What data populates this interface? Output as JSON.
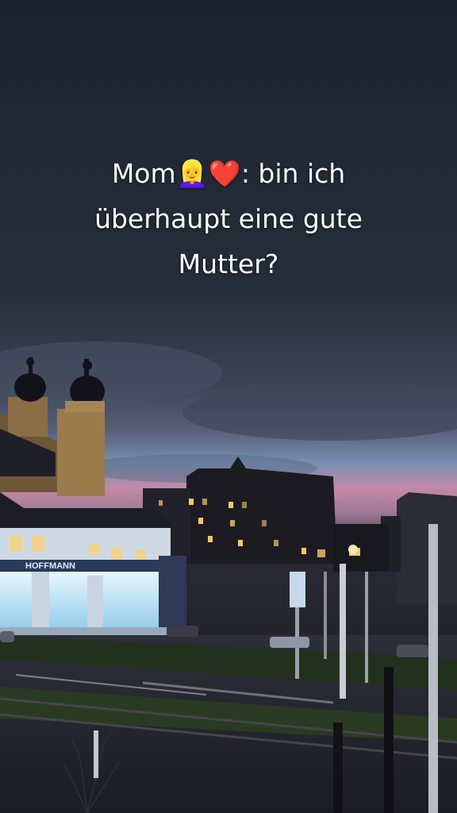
{
  "caption": {
    "line1_prefix": "Mom",
    "line1_emoji_person": "👱‍♀️",
    "line1_emoji_heart": "❤️",
    "line1_suffix": ": bin ich",
    "line2": "überhaupt eine gute",
    "line3": "Mutter?"
  },
  "scene": {
    "storefront_sign": "HOFFMANN",
    "colors": {
      "sky_top": "#1d2430",
      "sky_mid": "#3a4250",
      "sunset_pink": "#c58aa8",
      "sunset_blue": "#6d8fb3",
      "building_dark": "#1a1a22",
      "window_light": "#f3c76a",
      "shop_light": "#d9f0ff"
    }
  }
}
